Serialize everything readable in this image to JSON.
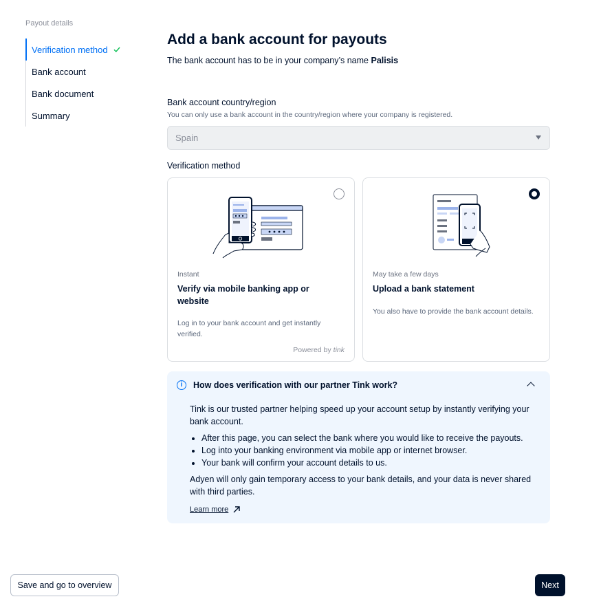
{
  "sidebar": {
    "heading": "Payout details",
    "steps": [
      {
        "label": "Verification method",
        "active": true,
        "completed": true
      },
      {
        "label": "Bank account"
      },
      {
        "label": "Bank document"
      },
      {
        "label": "Summary"
      }
    ]
  },
  "main": {
    "title": "Add a bank account for payouts",
    "subtitle_prefix": "The bank account has to be in your company’s name",
    "company_name": "Palisis",
    "country_field": {
      "label": "Bank account country/region",
      "help": "You can only use a bank account in the country/region where your company is registered.",
      "value": "Spain"
    },
    "verification_label": "Verification method",
    "options": [
      {
        "kicker": "Instant",
        "title": "Verify via mobile banking app or website",
        "description": "Log in to your bank account and get instantly verified.",
        "powered_by": "Powered by",
        "brand": "tink",
        "selected": false
      },
      {
        "kicker": "May take a few days",
        "title": "Upload a bank statement",
        "description": "You also have to provide the bank account details.",
        "selected": true
      }
    ],
    "info": {
      "title": "How does verification with our partner Tink work?",
      "intro": "Tink is our trusted partner helping speed up your account setup by instantly verifying your bank account.",
      "bullets": [
        "After this page, you can select the bank where you would like to receive the payouts.",
        "Log into your banking environment via mobile app or internet browser.",
        "Your bank will confirm your account details to us."
      ],
      "outro": "Adyen will only gain temporary access to your bank details, and your data is never shared with third parties.",
      "link": "Learn more"
    }
  },
  "footer": {
    "secondary_label": "Save and go to overview",
    "primary_label": "Next"
  },
  "colors": {
    "accent": "#0070f5",
    "primary": "#00112c",
    "info_bg": "#eff6fe"
  }
}
